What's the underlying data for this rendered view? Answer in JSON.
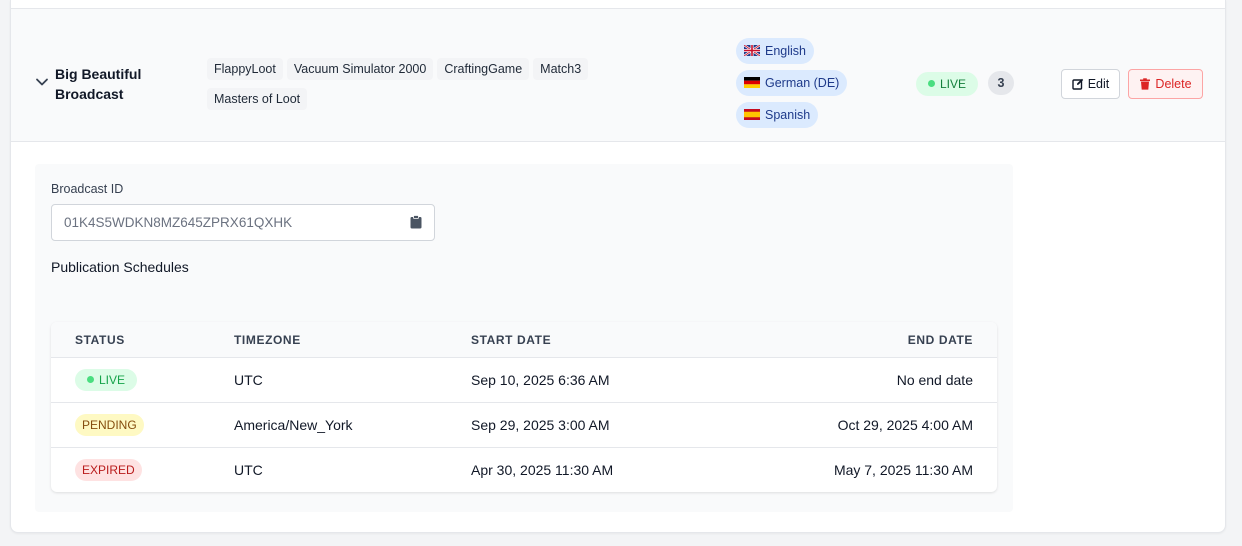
{
  "broadcast": {
    "name": "Big Beautiful Broadcast",
    "games": [
      "FlappyLoot",
      "Vacuum Simulator 2000",
      "CraftingGame",
      "Match3",
      "Masters of Loot"
    ],
    "languages": [
      {
        "flag": "uk-flag-icon",
        "label": "English"
      },
      {
        "flag": "de-flag-icon",
        "label": "German (DE)"
      },
      {
        "flag": "es-flag-icon",
        "label": "Spanish"
      }
    ],
    "status": "LIVE",
    "schedule_count": "3",
    "edit_label": "Edit",
    "delete_label": "Delete"
  },
  "details": {
    "id_label": "Broadcast ID",
    "id_value": "01K4S5WDKN8MZ645ZPRX61QXHK",
    "schedules_title": "Publication Schedules",
    "table": {
      "headers": [
        "STATUS",
        "TIMEZONE",
        "START DATE",
        "END DATE"
      ],
      "rows": [
        {
          "status": "LIVE",
          "timezone": "UTC",
          "start": "Sep 10, 2025 6:36 AM",
          "end": "No end date"
        },
        {
          "status": "PENDING",
          "timezone": "America/New_York",
          "start": "Sep 29, 2025 3:00 AM",
          "end": "Oct 29, 2025 4:00 AM"
        },
        {
          "status": "EXPIRED",
          "timezone": "UTC",
          "start": "Apr 30, 2025 11:30 AM",
          "end": "May 7, 2025 11:30 AM"
        }
      ]
    }
  },
  "colors": {
    "live_bg": "#dcfce7",
    "live_fg": "#16a34a",
    "pending_bg": "#fef9c3",
    "pending_fg": "#854d0e",
    "expired_bg": "#fee2e2",
    "expired_fg": "#b91c1c",
    "lang_bg": "#dbeafe",
    "delete": "#dc2626"
  }
}
